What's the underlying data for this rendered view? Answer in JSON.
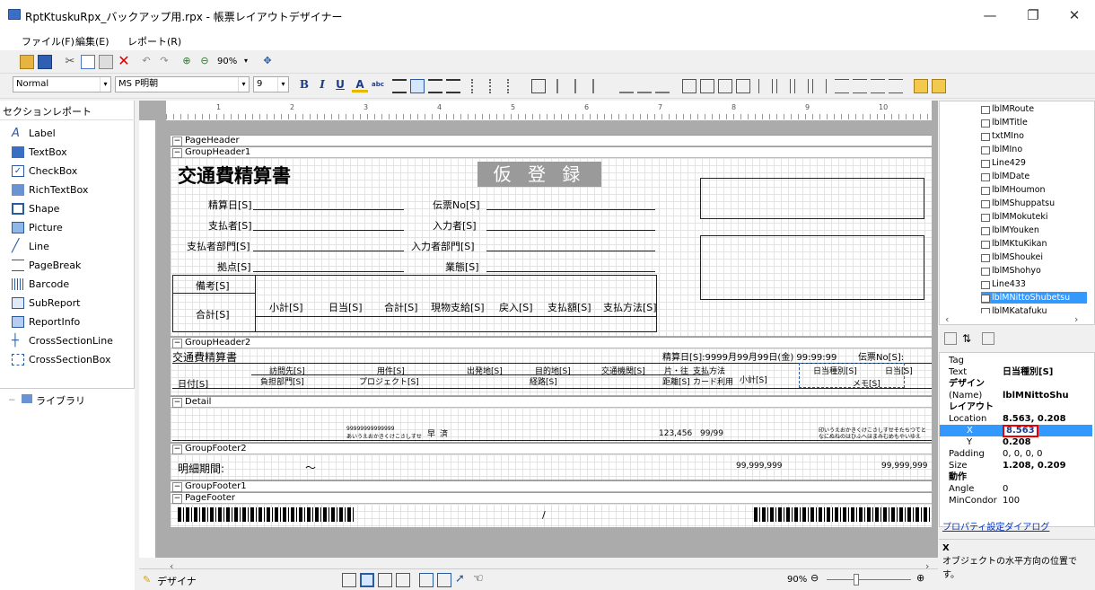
{
  "window": {
    "title": "RptKtuskuRpx_バックアップ用.rpx - 帳票レイアウトデザイナー",
    "minimize": "—",
    "restore": "❐",
    "close": "✕"
  },
  "menu": [
    "ファイル(F)",
    "編集(E)",
    "レポート(R)"
  ],
  "toolbar": {
    "zoom": "90%",
    "style": "Normal",
    "font": "MS P明朝",
    "size": "9",
    "bold": "B",
    "italic": "I",
    "underline": "U",
    "fontcolor": "A",
    "spell": "abc"
  },
  "toolbox": {
    "header": "セクションレポート",
    "items": [
      "Label",
      "TextBox",
      "CheckBox",
      "RichTextBox",
      "Shape",
      "Picture",
      "Line",
      "PageBreak",
      "Barcode",
      "SubReport",
      "ReportInfo",
      "CrossSectionLine",
      "CrossSectionBox"
    ],
    "library": "ライブラリ"
  },
  "ruler": [
    "1",
    "2",
    "3",
    "4",
    "5",
    "6",
    "7",
    "8",
    "9",
    "10"
  ],
  "sections": {
    "page_header": "PageHeader",
    "group_header1": "GroupHeader1",
    "group_header2": "GroupHeader2",
    "detail": "Detail",
    "group_footer2": "GroupFooter2",
    "group_footer1": "GroupFooter1",
    "page_footer": "PageFooter"
  },
  "gh1": {
    "title": "交通費精算書",
    "stamp": "仮 登 録",
    "seisanbi": "精算日[S]",
    "shiharaisha": "支払者[S]",
    "shiharai_bumon": "支払者部門[S]",
    "kyoten": "拠点[S]",
    "denpyo": "伝票No[S]",
    "nyuryokusha": "入力者[S]",
    "nyuryoku_bumon": "入力者部門[S]",
    "gyotai": "業態[S]",
    "biko": "備考[S]",
    "gokei": "合計[S]",
    "cols": [
      "小計[S]",
      "日当[S]",
      "合計[S]",
      "現物支給[S]",
      "戻入[S]",
      "支払額[S]",
      "支払方法[S]"
    ]
  },
  "gh2": {
    "title": "交通費精算書",
    "date": "精算日[S]:9999月99月99日(金) 99:99:99",
    "denpyo": "伝票No[S]:",
    "hizuke": "日付[S]",
    "homon": "訪問先[S]",
    "yoken": "用件[S]",
    "shupatsu": "出発地[S]",
    "mokuteki": "目的地[S]",
    "kotsu": "交通機関[S]",
    "kata": "片・往",
    "shiharai": "支払方法",
    "shokei": "小計[S]",
    "nitto": "日当種別[S]",
    "nitto2": "日当[S]",
    "futan": "負担部門[S]",
    "project": "プロジェクト[S]",
    "keiro": "経路[S]",
    "kyori": "距離[S]",
    "card": "カード利用",
    "memo": "メモ[S]"
  },
  "detail": {
    "sample1": "99999999999999",
    "sample2": "あいうえおかきくけこさしすせ",
    "sample3": "早",
    "sample4": "済",
    "num": "123,456",
    "date": "99/99",
    "text1": "印いうえおかきくけこさしすせそたちつてと",
    "text2": "なにぬねのはひふへほまみむめもやいゆえ"
  },
  "gf2": {
    "label": "明細期間:",
    "tilde": "〜",
    "amt1": "99,999,999",
    "amt2": "99,999,999"
  },
  "pf": {
    "slash": "/"
  },
  "status": {
    "mode": "デザイナ",
    "zoom": "90%"
  },
  "tree": [
    "lblMRoute",
    "lblMTitle",
    "txtMIno",
    "lblMIno",
    "Line429",
    "lblMDate",
    "lblMHoumon",
    "lblMShuppatsu",
    "lblMMokuteki",
    "lblMYouken",
    "lblMKtuKikan",
    "lblMShoukei",
    "lblMShohyo",
    "Line433",
    "lblMNittoShubetsu",
    "lblMKatafuku"
  ],
  "props": {
    "tag": "Tag",
    "text_k": "Text",
    "text_v": "日当種別[S]",
    "design": "デザイン",
    "name_k": "(Name)",
    "name_v": "lblMNittoShu",
    "layout": "レイアウト",
    "loc_k": "Location",
    "loc_v": "8.563, 0.208",
    "x_k": "X",
    "x_v": "8.563",
    "y_k": "Y",
    "y_v": "0.208",
    "pad_k": "Padding",
    "pad_v": "0, 0, 0, 0",
    "size_k": "Size",
    "size_v": "1.208, 0.209",
    "action": "動作",
    "angle_k": "Angle",
    "angle_v": "0",
    "min_k": "MinCondor",
    "min_v": "100",
    "dialog": "プロパティ設定ダイアログ",
    "desc_title": "X",
    "desc": "オブジェクトの水平方向の位置です。"
  }
}
